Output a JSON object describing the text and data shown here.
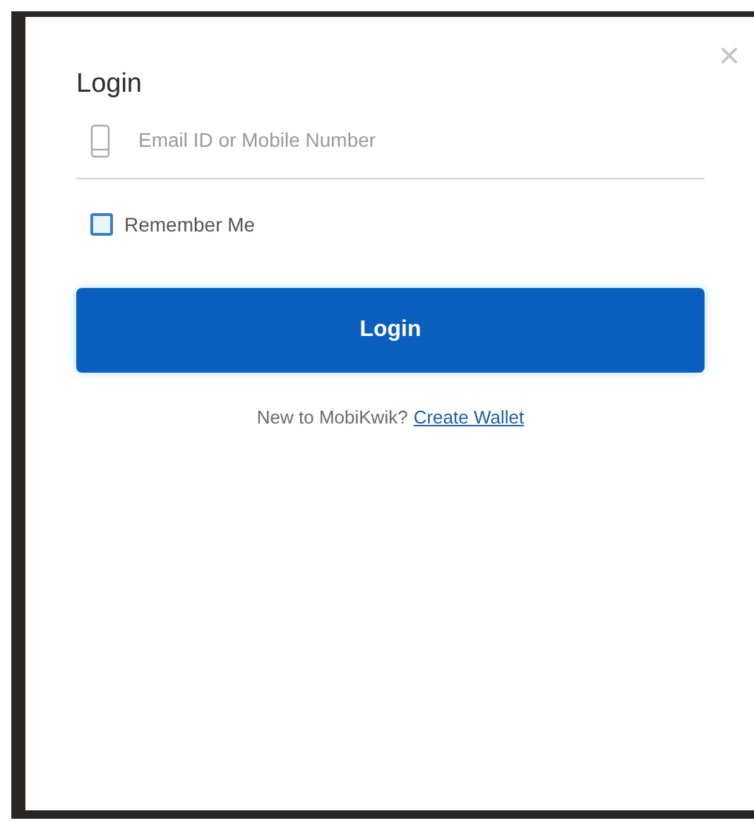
{
  "dialog": {
    "title": "Login",
    "close": "×"
  },
  "login_field": {
    "placeholder": "Email ID or Mobile Number"
  },
  "remember_me": {
    "label": "Remember Me",
    "checked": false
  },
  "submit_button": "Login",
  "signup_prompt": {
    "text": "New to MobiKwik?",
    "link": "Create Wallet"
  }
}
